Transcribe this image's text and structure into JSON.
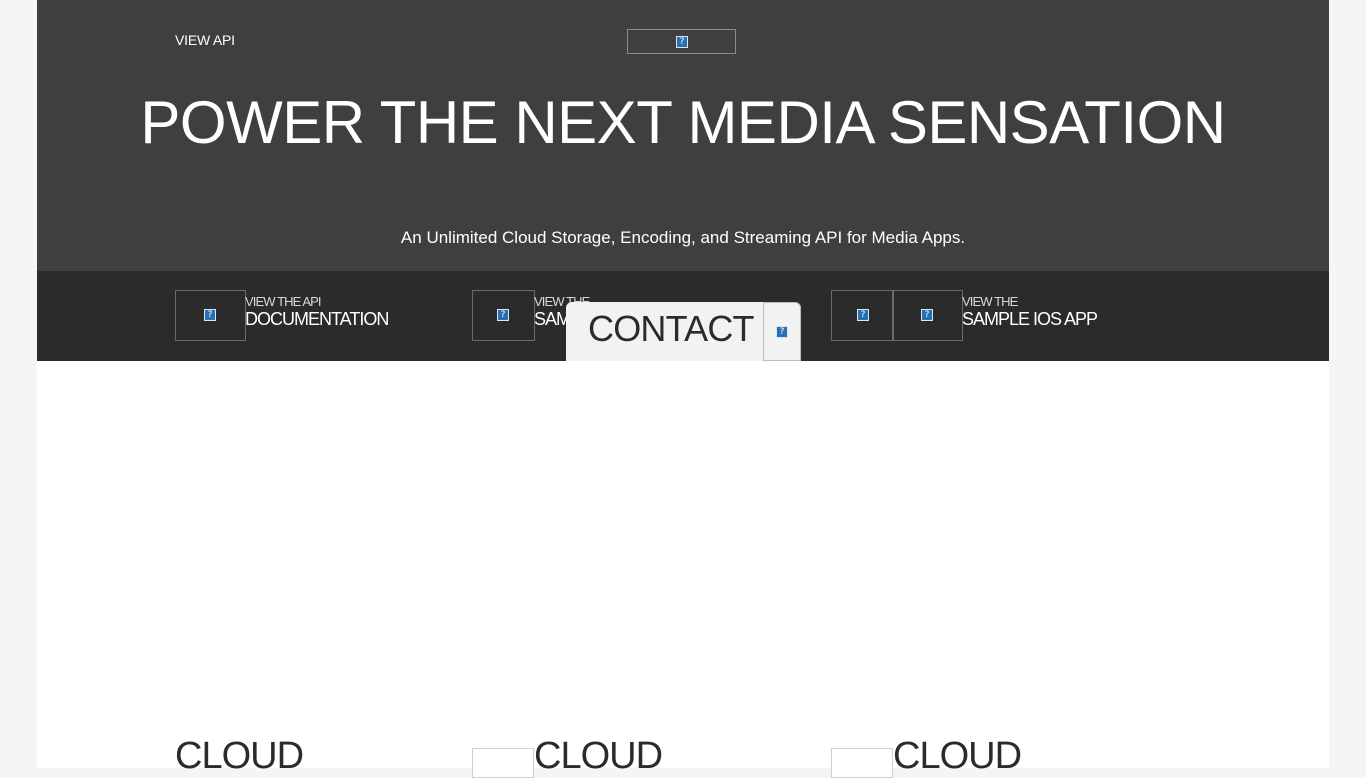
{
  "header": {
    "nav_link": "VIEW API",
    "logo_icon": "broken-image-icon"
  },
  "hero": {
    "title": "POWER THE NEXT MEDIA SENSATION",
    "subtitle": "An Unlimited Cloud Storage, Encoding, and Streaming API for Media Apps."
  },
  "cta": [
    {
      "small": "VIEW THE API",
      "big": "DOCUMENTATION",
      "icon": "broken-image-icon"
    },
    {
      "small": "VIEW THE",
      "big": "SAM",
      "icon": "broken-image-icon"
    },
    {
      "small": "VIEW THE",
      "big": "SAMPLE IOS APP",
      "icon": "broken-image-icon"
    }
  ],
  "contact": {
    "label": "CONTACT",
    "icon": "broken-image-icon"
  },
  "features": [
    {
      "heading": "CLOUD"
    },
    {
      "heading": "CLOUD"
    },
    {
      "heading": "CLOUD"
    }
  ],
  "colors": {
    "hero_bg": "#3f3f3f",
    "cta_bar_bg": "#2b2b2b",
    "page_bg": "#f5f5f5",
    "contact_tab_bg": "#f2f2f2"
  }
}
